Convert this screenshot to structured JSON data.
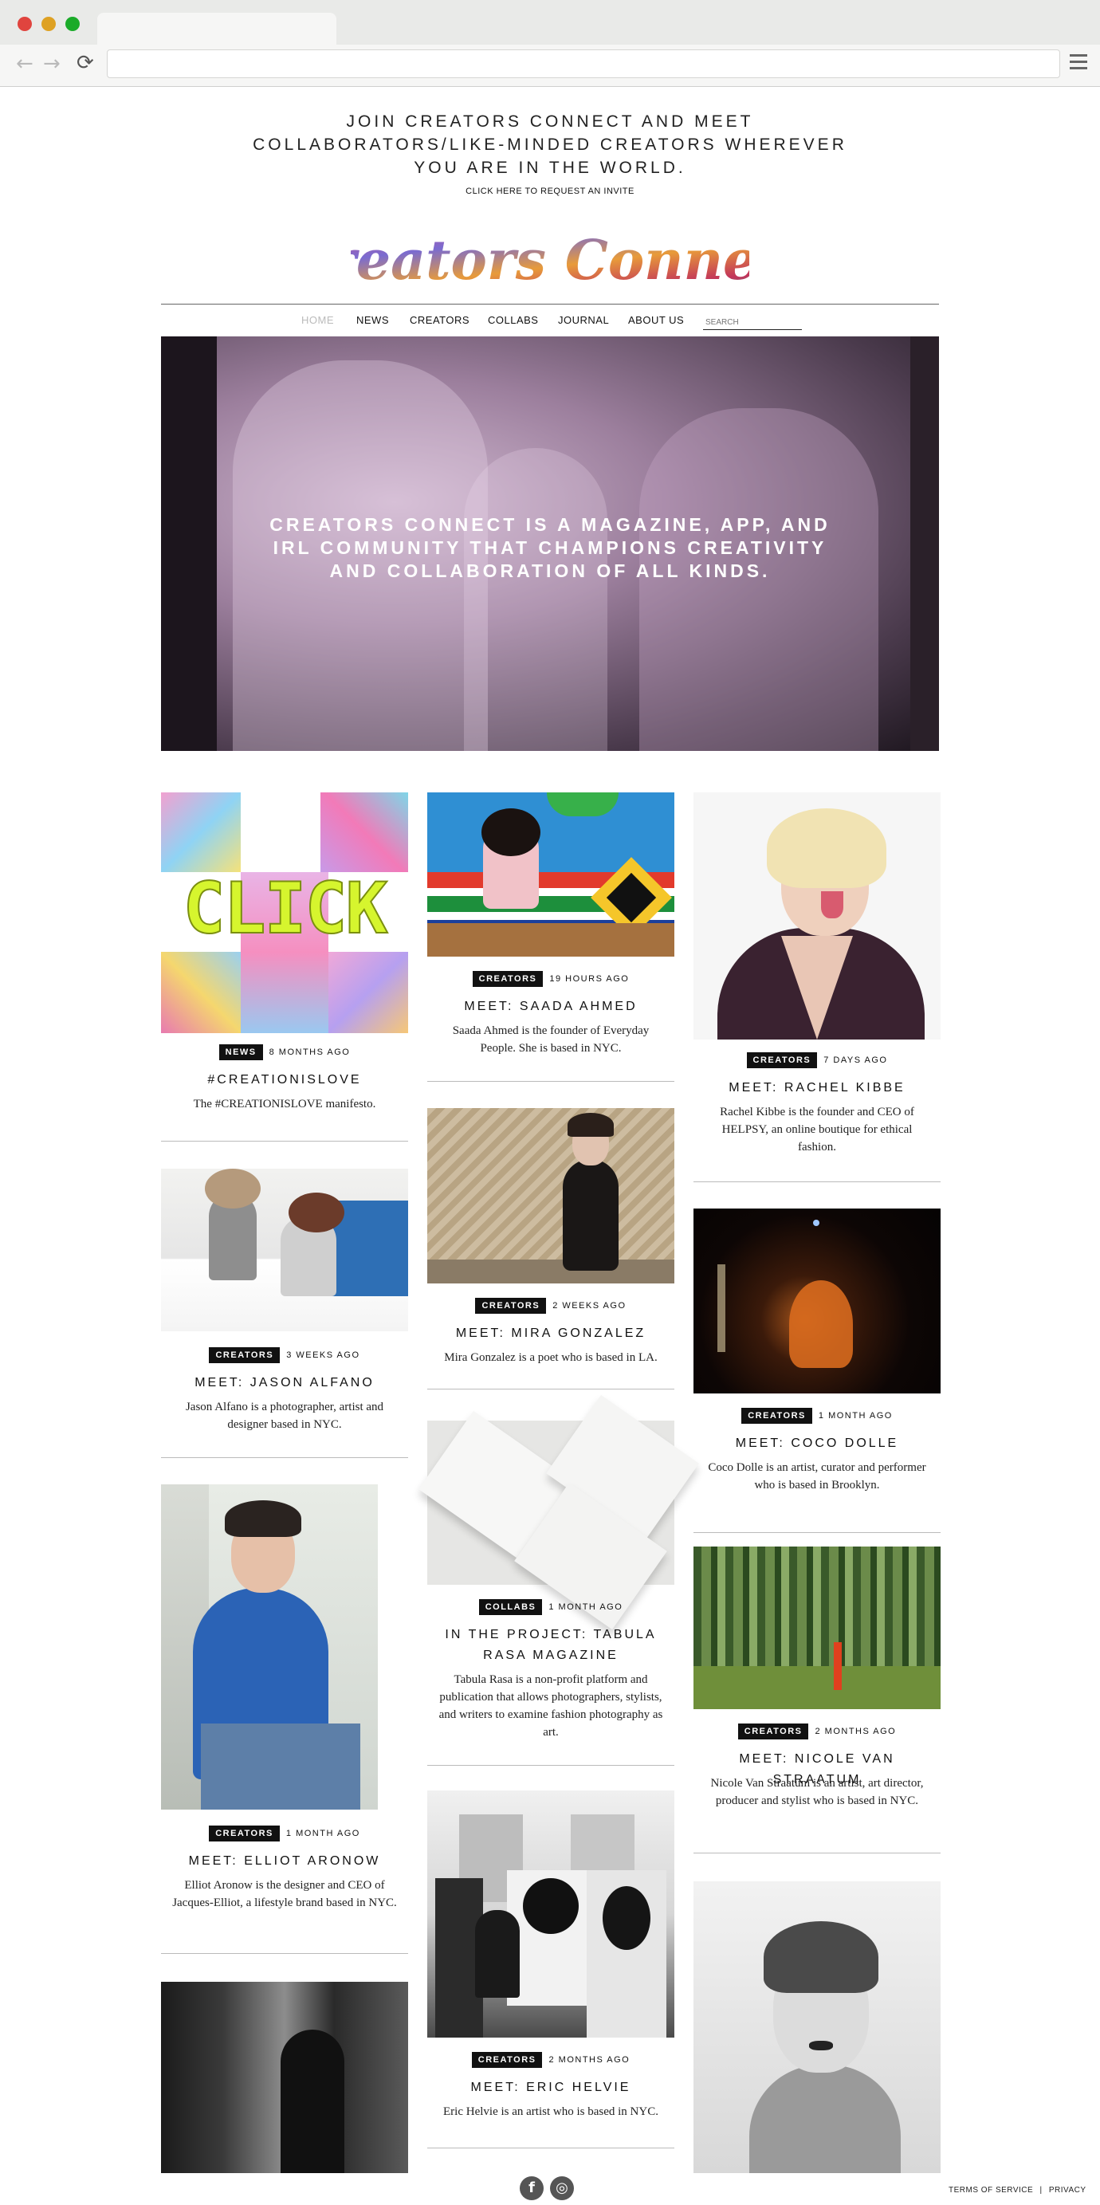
{
  "promo": {
    "line1": "JOIN CREATORS CONNECT AND MEET",
    "line2": "COLLABORATORS/LIKE-MINDED CREATORS WHEREVER",
    "line3": "YOU ARE IN THE WORLD.",
    "link": "CLICK HERE TO REQUEST AN INVITE"
  },
  "logo": {
    "text": "Creators Connect"
  },
  "nav": {
    "items": [
      "HOME",
      "NEWS",
      "CREATORS",
      "COLLABS",
      "JOURNAL",
      "ABOUT US"
    ],
    "search_placeholder": "SEARCH"
  },
  "hero": {
    "text": "CREATORS CONNECT IS A MAGAZINE, APP, AND IRL COMMUNITY THAT CHAMPIONS CREATIVITY AND COLLABORATION OF ALL KINDS."
  },
  "cards": {
    "c1": {
      "image_text": "CLICK",
      "badge": "NEWS",
      "time": "8 MONTHS AGO",
      "title": "#CREATIONISLOVE",
      "desc": "The #CREATIONISLOVE manifesto."
    },
    "c2": {
      "badge": "CREATORS",
      "time": "3 WEEKS AGO",
      "title": "MEET: JASON ALFANO",
      "desc": "Jason Alfano is a photographer, artist and designer based in NYC."
    },
    "c3": {
      "badge": "CREATORS",
      "time": "1 MONTH AGO",
      "title": "MEET: ELLIOT ARONOW",
      "desc": "Elliot Aronow is the designer and CEO of Jacques-Elliot, a lifestyle brand based in NYC."
    },
    "c4": {
      "badge": "CREATORS",
      "time": "19 HOURS AGO",
      "title": "MEET: SAADA AHMED",
      "desc": "Saada Ahmed is the founder of Everyday People. She is based in NYC."
    },
    "c5": {
      "badge": "CREATORS",
      "time": "2 WEEKS AGO",
      "title": "MEET: MIRA GONZALEZ",
      "desc": "Mira Gonzalez is a poet who is based in LA."
    },
    "c6": {
      "badge": "COLLABS",
      "time": "1 MONTH AGO",
      "title": "IN THE PROJECT: TABULA RASA MAGAZINE",
      "desc": "Tabula Rasa is a non-profit platform and publication that allows photographers, stylists, and writers to examine fashion photography as art."
    },
    "c7": {
      "badge": "CREATORS",
      "time": "2 MONTHS AGO",
      "title": "MEET: ERIC HELVIE",
      "desc": "Eric Helvie is an artist who is based in NYC."
    },
    "c8": {
      "badge": "CREATORS",
      "time": "7 DAYS AGO",
      "title": "MEET: RACHEL KIBBE",
      "desc": "Rachel Kibbe is the founder and CEO of HELPSY, an online boutique for ethical fashion."
    },
    "c9": {
      "badge": "CREATORS",
      "time": "1 MONTH AGO",
      "title": "MEET: COCO DOLLE",
      "desc": "Coco Dolle is an artist, curator and performer who is based in Brooklyn."
    },
    "c10": {
      "badge": "CREATORS",
      "time": "2 MONTHS AGO",
      "title": "MEET: NICOLE VAN STRAATUM",
      "desc": "Nicole Van Straatum is an artist, art director, producer and stylist who is based in NYC."
    }
  },
  "footer": {
    "facebook": "f",
    "instagram": "◎",
    "terms": "TERMS OF SERVICE",
    "divider": "|",
    "privacy": "PRIVACY"
  }
}
